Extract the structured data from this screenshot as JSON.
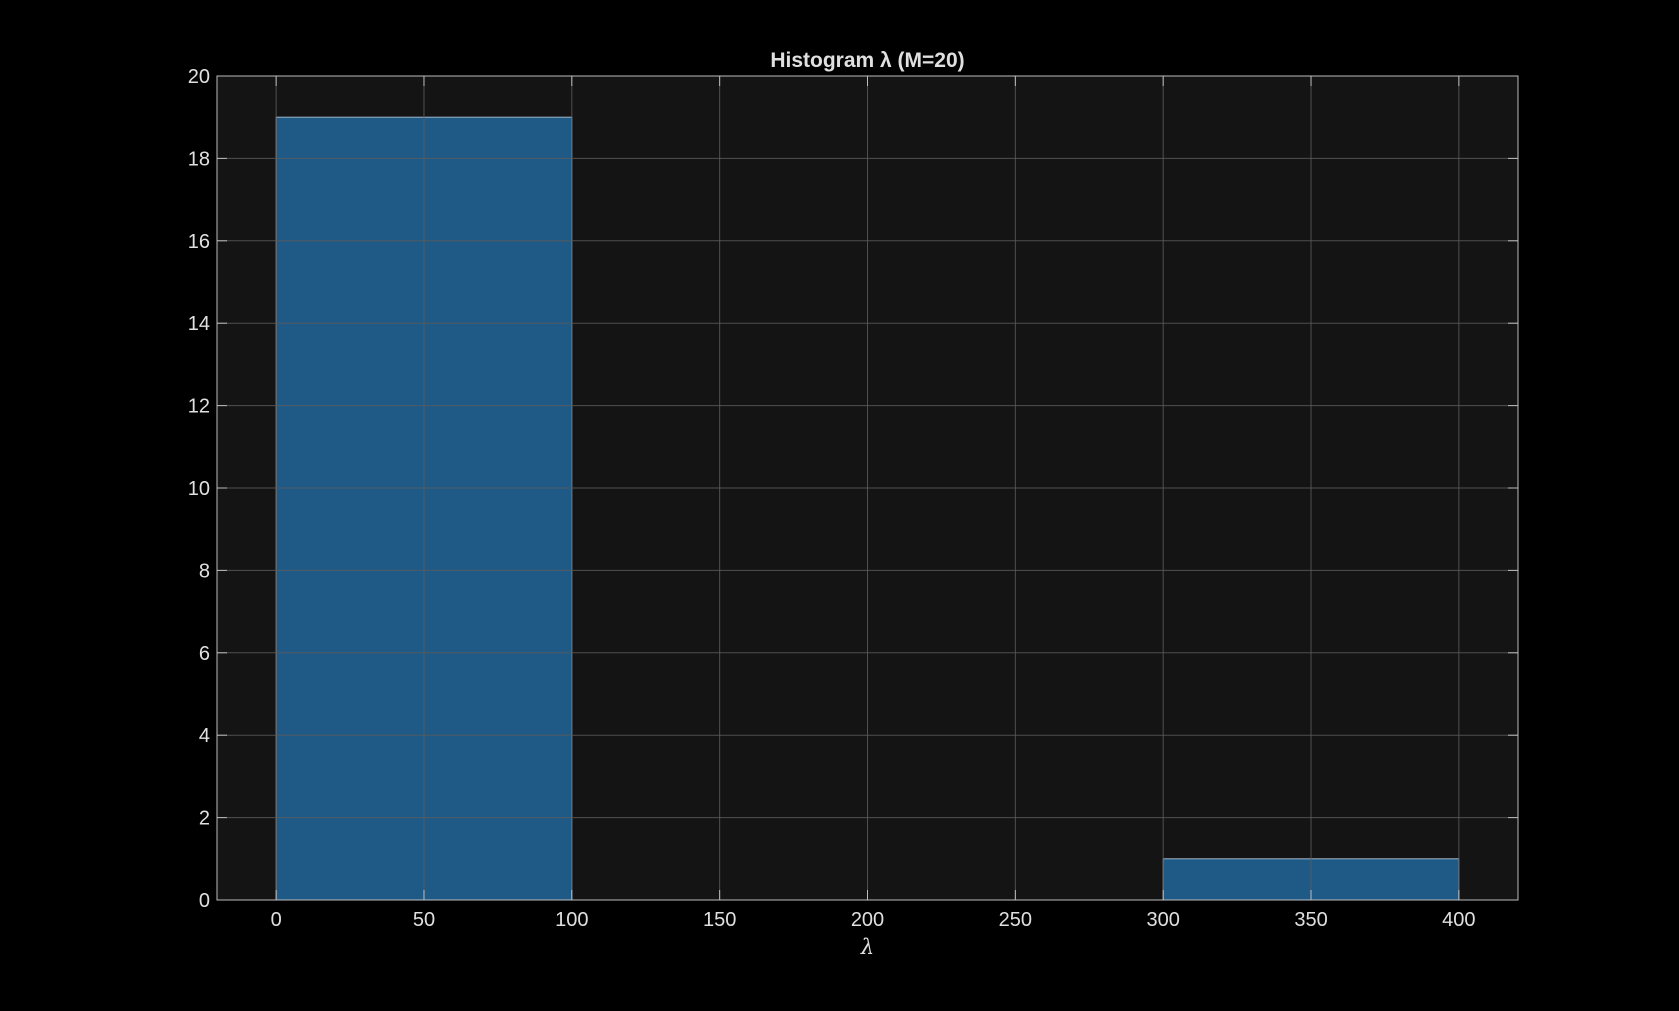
{
  "chart_data": {
    "type": "histogram",
    "title": "Histogram λ (M=20)",
    "xlabel": "λ",
    "ylabel": "",
    "bin_edges": [
      0,
      100,
      200,
      300,
      400
    ],
    "counts": [
      19,
      0,
      0,
      1
    ],
    "xlim": [
      -20,
      420
    ],
    "ylim": [
      0,
      20
    ],
    "xticks": [
      0,
      50,
      100,
      150,
      200,
      250,
      300,
      350,
      400
    ],
    "yticks": [
      0,
      2,
      4,
      6,
      8,
      10,
      12,
      14,
      16,
      18,
      20
    ],
    "grid": true,
    "colors": {
      "figure_background": "#000000",
      "axes_background": "#141414",
      "bar_fill": "#1f5a87",
      "bar_edge": "#9fb6c8",
      "grid": "#5a5a5a",
      "axis_line": "#bdbdbd",
      "text": "#e0e0e0"
    }
  }
}
